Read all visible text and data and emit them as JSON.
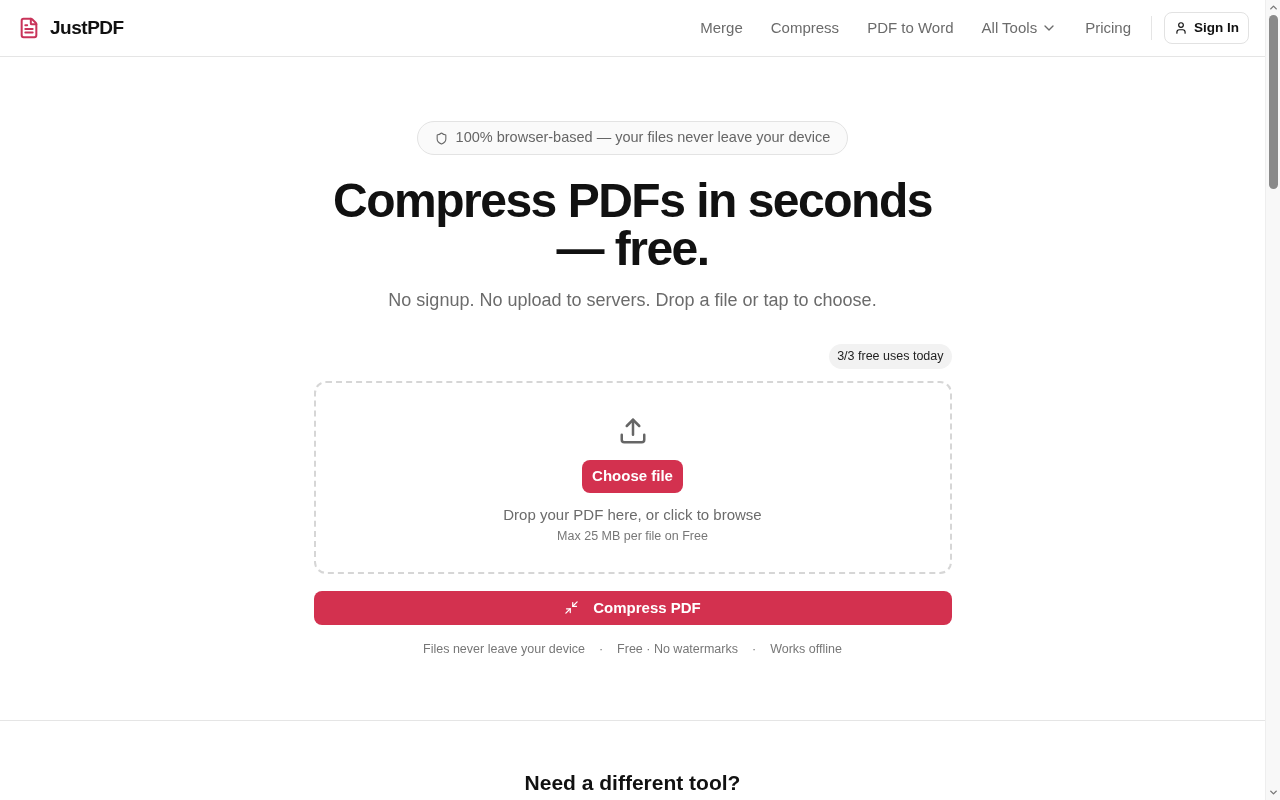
{
  "header": {
    "logo": "JustPDF",
    "nav": [
      {
        "label": "Merge",
        "kind": "link"
      },
      {
        "label": "Compress",
        "kind": "link"
      },
      {
        "label": "PDF to Word",
        "kind": "link"
      },
      {
        "label": "All Tools",
        "kind": "dropdown"
      },
      {
        "label": "Pricing",
        "kind": "link"
      }
    ],
    "sign_in": "Sign In"
  },
  "hero": {
    "badge": "100% browser-based — your files never leave your device",
    "title": "Compress PDFs in seconds — free.",
    "subtitle": "No signup. No upload to servers. Drop a file or tap to choose.",
    "usage": "3/3 free uses today",
    "dropzone": {
      "button": "Choose file",
      "hint": "Drop your PDF here, or click to browse",
      "limit": "Max 25 MB per file on Free"
    },
    "action": "Compress PDF",
    "features": [
      "Files never leave your device",
      "Free · No watermarks",
      "Works offline"
    ],
    "separator": "·"
  },
  "next_section": {
    "title": "Need a different tool?"
  }
}
